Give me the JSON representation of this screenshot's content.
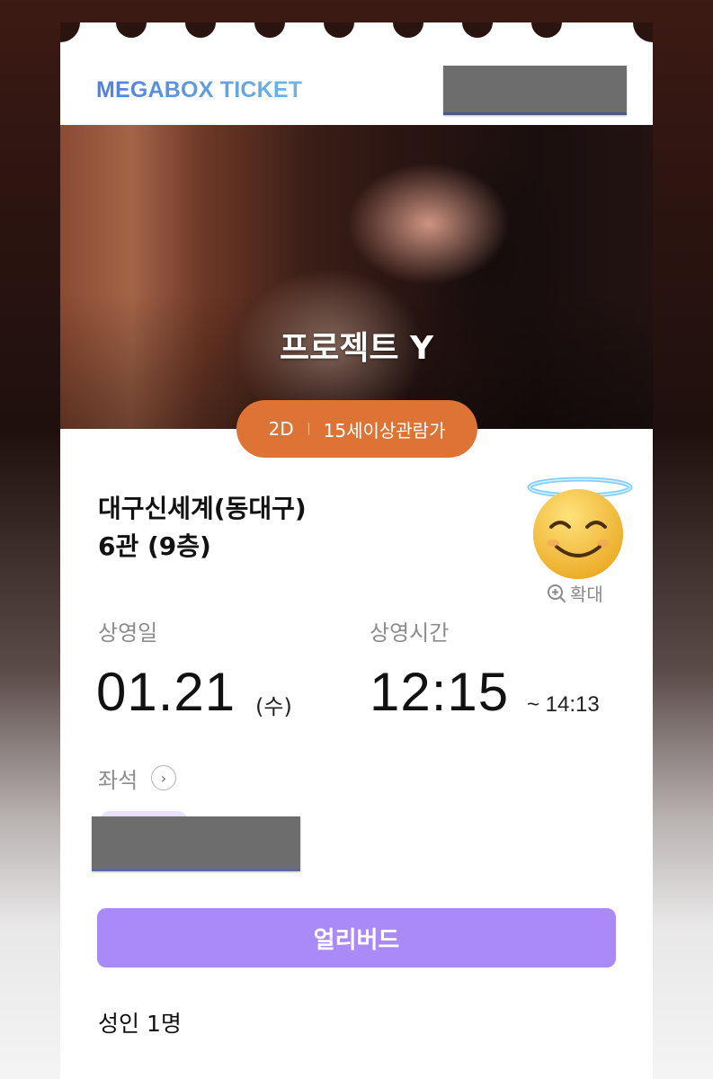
{
  "brand": "MEGABOX TICKET",
  "movie": {
    "title": "프로젝트 Y",
    "format": "2D",
    "rating": "15세이상관람가"
  },
  "theater": {
    "name": "대구신세계(동대구)",
    "hall": "6관 (9층)"
  },
  "zoom_label": "확대",
  "showing": {
    "date_label": "상영일",
    "date": "01.21",
    "day_of_week": "(수)",
    "time_label": "상영시간",
    "start_time": "12:15",
    "end_time": "~ 14:13"
  },
  "seat_label": "좌석",
  "early_bird_label": "얼리버드",
  "people": "성인 1명",
  "colors": {
    "accent_orange": "#dd7335",
    "accent_purple": "#a98af7",
    "brand_blue": "#4f7fe0"
  }
}
